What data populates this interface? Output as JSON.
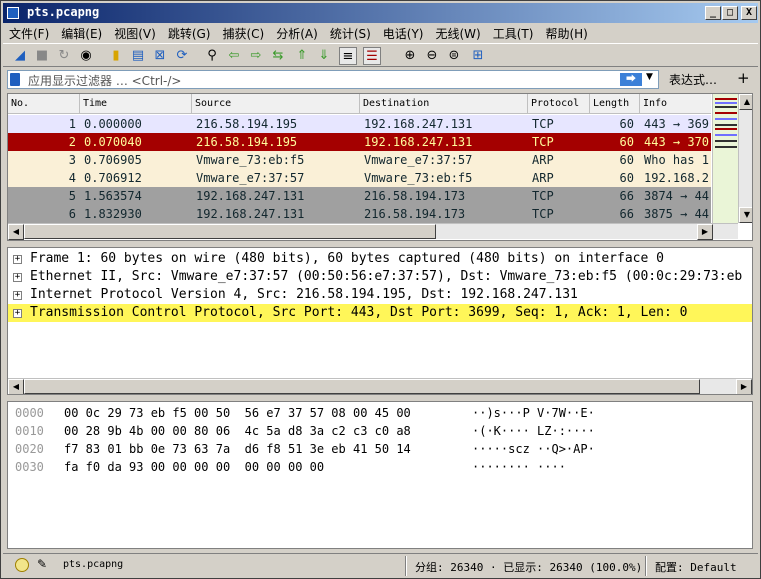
{
  "window": {
    "title": "pts.pcapng",
    "minimize": "_",
    "maximize": "□",
    "close": "X"
  },
  "menu": [
    "文件(F)",
    "编辑(E)",
    "视图(V)",
    "跳转(G)",
    "捕获(C)",
    "分析(A)",
    "统计(S)",
    "电话(Y)",
    "无线(W)",
    "工具(T)",
    "帮助(H)"
  ],
  "filter": {
    "placeholder": "应用显示过滤器 … <Ctrl-/>",
    "apply": "⮕",
    "dropdown": "▼",
    "expression": "表达式…",
    "add": "+"
  },
  "packet_list": {
    "columns": [
      "No.",
      "Time",
      "Source",
      "Destination",
      "Protocol",
      "Length",
      "Info"
    ],
    "rows": [
      {
        "no": "1",
        "time": "0.000000",
        "src": "216.58.194.195",
        "dst": "192.168.247.131",
        "proto": "TCP",
        "len": "60",
        "info": "443 → 369",
        "bg": "#e7e6ff",
        "fg": "#12272e"
      },
      {
        "no": "2",
        "time": "0.070040",
        "src": "216.58.194.195",
        "dst": "192.168.247.131",
        "proto": "TCP",
        "len": "60",
        "info": "443 → 370",
        "bg": "#a40000",
        "fg": "#fffc9c"
      },
      {
        "no": "3",
        "time": "0.706905",
        "src": "Vmware_73:eb:f5",
        "dst": "Vmware_e7:37:57",
        "proto": "ARP",
        "len": "60",
        "info": "Who has 1",
        "bg": "#faf0d7",
        "fg": "#12272e"
      },
      {
        "no": "4",
        "time": "0.706912",
        "src": "Vmware_e7:37:57",
        "dst": "Vmware_73:eb:f5",
        "proto": "ARP",
        "len": "60",
        "info": "192.168.2",
        "bg": "#faf0d7",
        "fg": "#12272e"
      },
      {
        "no": "5",
        "time": "1.563574",
        "src": "192.168.247.131",
        "dst": "216.58.194.173",
        "proto": "TCP",
        "len": "66",
        "info": "3874 → 44",
        "bg": "#a0a0a0",
        "fg": "#12272e"
      },
      {
        "no": "6",
        "time": "1.832930",
        "src": "192.168.247.131",
        "dst": "216.58.194.173",
        "proto": "TCP",
        "len": "66",
        "info": "3875 → 44",
        "bg": "#a0a0a0",
        "fg": "#12272e"
      }
    ]
  },
  "details": [
    "Frame 1: 60 bytes on wire (480 bits), 60 bytes captured (480 bits) on interface 0",
    "Ethernet II, Src: Vmware_e7:37:57 (00:50:56:e7:37:57), Dst: Vmware_73:eb:f5 (00:0c:29:73:eb",
    "Internet Protocol Version 4, Src: 216.58.194.195, Dst: 192.168.247.131",
    "Transmission Control Protocol, Src Port: 443, Dst Port: 3699, Seq: 1, Ack: 1, Len: 0"
  ],
  "hex_dump": [
    {
      "offset": "0000",
      "bytes": "00 0c 29 73 eb f5 00 50  56 e7 37 57 08 00 45 00",
      "ascii": "··)s···P V·7W··E·"
    },
    {
      "offset": "0010",
      "bytes": "00 28 9b 4b 00 00 80 06  4c 5a d8 3a c2 c3 c0 a8",
      "ascii": "·(·K···· LZ·:····"
    },
    {
      "offset": "0020",
      "bytes": "f7 83 01 bb 0e 73 63 7a  d6 f8 51 3e eb 41 50 14",
      "ascii": "·····scz ··Q>·AP·"
    },
    {
      "offset": "0030",
      "bytes": "fa f0 da 93 00 00 00 00  00 00 00 00",
      "ascii": "········ ····"
    }
  ],
  "status": {
    "file": "pts.pcapng",
    "packets": "分组: 26340 · 已显示: 26340 (100.0%)",
    "profile": "配置: Default"
  }
}
